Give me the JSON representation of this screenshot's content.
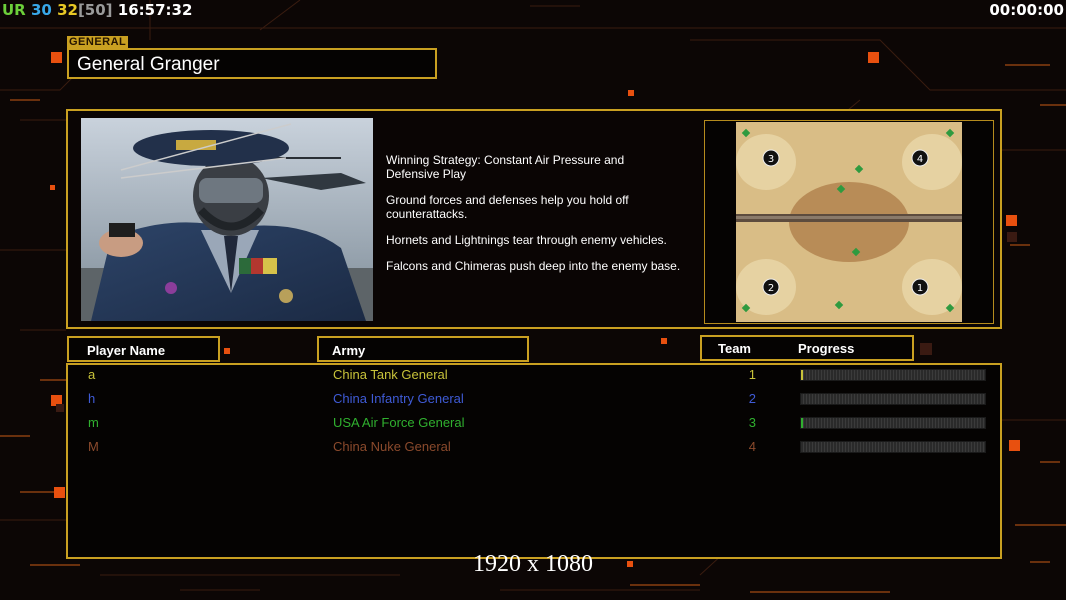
{
  "hud": {
    "ur_label": "UR",
    "ur_value": "30",
    "count_value": "32",
    "count_bracket": "[50]",
    "clock": "16:57:32",
    "game_timer": "00:00:00"
  },
  "general": {
    "section_label": "GENERAL",
    "name": "General Granger",
    "strategy": [
      "Winning Strategy: Constant Air Pressure and\n Defensive Play",
      "Ground forces and defenses help you hold off\n counterattacks.",
      "Hornets and Lightnings tear through enemy vehicles.",
      "Falcons and Chimeras push deep into the enemy base."
    ]
  },
  "map": {
    "start_positions": [
      "3",
      "4",
      "2",
      "1"
    ]
  },
  "headers": {
    "player_name": "Player Name",
    "army": "Army",
    "team": "Team",
    "progress": "Progress"
  },
  "players": [
    {
      "name": "a",
      "army": "China Tank General",
      "team": "1",
      "color": "#c8c33a",
      "progress": 0.01
    },
    {
      "name": "h",
      "army": "China Infantry General",
      "team": "2",
      "color": "#3f5bd6",
      "progress": 0
    },
    {
      "name": "m",
      "army": "USA Air Force General",
      "team": "3",
      "color": "#30b02f",
      "progress": 0.01
    },
    {
      "name": "M",
      "army": "China Nuke General",
      "team": "4",
      "color": "#8b4a2c",
      "progress": 0
    }
  ],
  "hud_colors": {
    "ur": "#6ccf3a",
    "ur_value": "#38a7e8",
    "count": "#e8c825",
    "bracket": "#9a9a9a"
  },
  "resolution_text": "1920 x 1080"
}
